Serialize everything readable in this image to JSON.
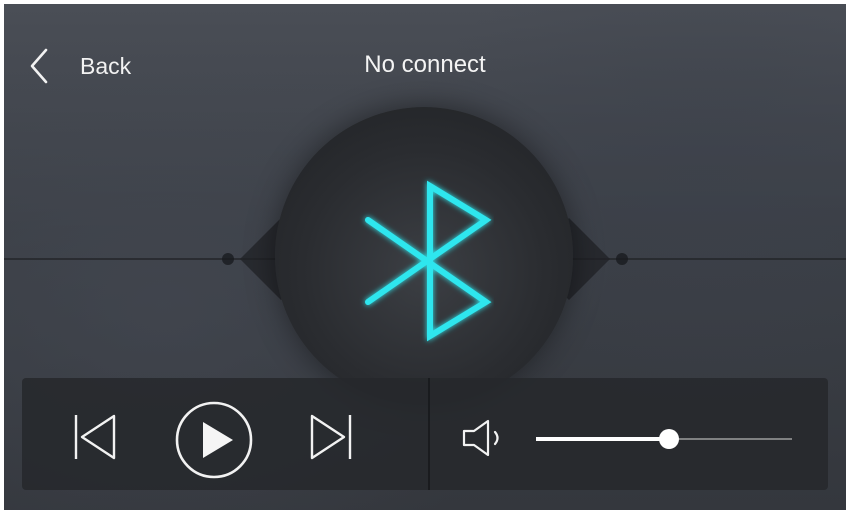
{
  "header": {
    "back_label": "Back",
    "title": "No connect"
  },
  "icons": {
    "back": "chevron-left-icon",
    "bluetooth": "bluetooth-icon",
    "previous": "skip-previous-icon",
    "play": "play-icon",
    "next": "skip-next-icon",
    "volume": "volume-icon"
  },
  "colors": {
    "bluetooth_accent": "#2ee6ee",
    "text": "#f2f2f2"
  },
  "volume": {
    "level": 0.52
  }
}
